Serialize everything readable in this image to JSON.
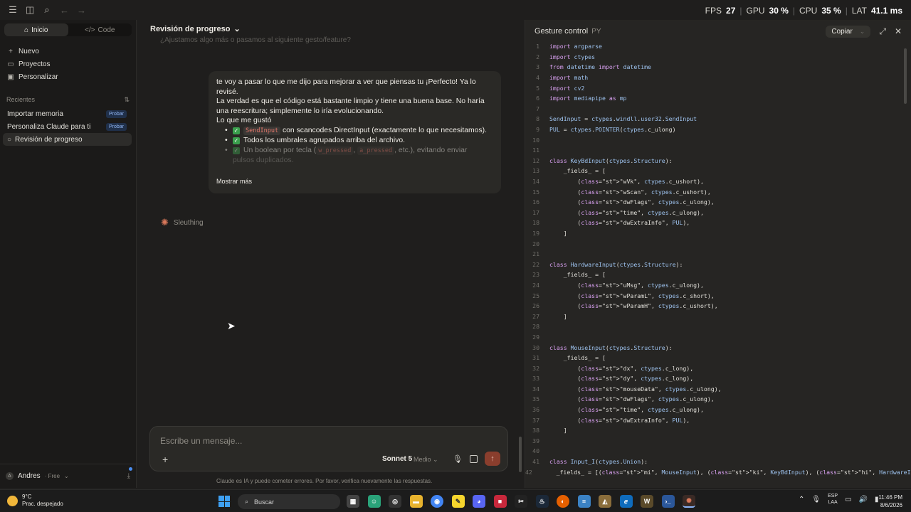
{
  "topbar": {
    "icons": [
      "menu-icon",
      "sidebar-toggle-icon",
      "search-icon",
      "back-icon",
      "forward-icon"
    ]
  },
  "overlay": {
    "fps_label": "FPS",
    "fps": "27",
    "gpu_label": "GPU",
    "gpu": "30 %",
    "cpu_label": "CPU",
    "cpu": "35 %",
    "lat_label": "LAT",
    "lat": "41.1 ms"
  },
  "sidebar": {
    "tabs": [
      {
        "label": "Inicio",
        "icon": "home-icon"
      },
      {
        "label": "Code",
        "icon": "code-icon"
      }
    ],
    "items": [
      {
        "label": "Nuevo",
        "icon": "plus-icon"
      },
      {
        "label": "Proyectos",
        "icon": "folder-icon"
      },
      {
        "label": "Personalizar",
        "icon": "briefcase-icon"
      }
    ],
    "recents_label": "Recientes",
    "recents": [
      {
        "label": "Importar memoria",
        "badge": "Probar"
      },
      {
        "label": "Personaliza Claude para ti",
        "badge": "Probar"
      },
      {
        "label": "Revisión de progreso",
        "badge": ""
      }
    ],
    "user": {
      "initial": "A",
      "name": "Andres",
      "plan": "· Free"
    }
  },
  "chat": {
    "title": "Revisión de progreso",
    "faded_text": "¿Ajustamos algo más o pasamos al siguiente gesto/feature?",
    "message": {
      "line1": "te voy a pasar lo que me dijo para mejorar a ver que piensas tu ¡Perfecto! Ya lo revisé.",
      "line2": "La verdad es que el código está bastante limpio y tiene una buena base. No haría una reescritura; simplemente lo iría evolucionando.",
      "line3": "Lo que me gustó",
      "bullet1_code": "SendInput",
      "bullet1_text": " con scancodes DirectInput (exactamente lo que necesitamos).",
      "bullet2_text": "Todos los umbrales agrupados arriba del archivo.",
      "bullet3_pre": "Un boolean por tecla (",
      "bullet3_code1": "w_pressed",
      "bullet3_mid": ", ",
      "bullet3_code2": "a_pressed",
      "bullet3_post": ", etc.), evitando enviar",
      "bullet3_cont": "pulsos duplicados.",
      "more": "Mostrar más"
    },
    "status": "Sleuthing",
    "composer": {
      "placeholder": "Escribe un mensaje...",
      "model": "Sonnet 5",
      "effort": "Medio"
    },
    "disclaimer": "Claude es IA y puede cometer errores. Por favor, verifica nuevamente las respuestas."
  },
  "code_panel": {
    "title": "Gesture control",
    "lang": "PY",
    "copy": "Copiar",
    "lines": [
      "import argparse",
      "import ctypes",
      "from datetime import datetime",
      "import math",
      "import cv2",
      "import mediapipe as mp",
      "",
      "SendInput = ctypes.windll.user32.SendInput",
      "PUL = ctypes.POINTER(ctypes.c_ulong)",
      "",
      "",
      "class KeyBdInput(ctypes.Structure):",
      "    _fields_ = [",
      "        (\"wVk\", ctypes.c_ushort),",
      "        (\"wScan\", ctypes.c_ushort),",
      "        (\"dwFlags\", ctypes.c_ulong),",
      "        (\"time\", ctypes.c_ulong),",
      "        (\"dwExtraInfo\", PUL),",
      "    ]",
      "",
      "",
      "class HardwareInput(ctypes.Structure):",
      "    _fields_ = [",
      "        (\"uMsg\", ctypes.c_ulong),",
      "        (\"wParamL\", ctypes.c_short),",
      "        (\"wParamH\", ctypes.c_ushort),",
      "    ]",
      "",
      "",
      "class MouseInput(ctypes.Structure):",
      "    _fields_ = [",
      "        (\"dx\", ctypes.c_long),",
      "        (\"dy\", ctypes.c_long),",
      "        (\"mouseData\", ctypes.c_ulong),",
      "        (\"dwFlags\", ctypes.c_ulong),",
      "        (\"time\", ctypes.c_ulong),",
      "        (\"dwExtraInfo\", PUL),",
      "    ]",
      "",
      "",
      "class Input_I(ctypes.Union):",
      "    _fields_ = [(\"mi\", MouseInput), (\"ki\", KeyBdInput), (\"hi\", HardwareInput)]"
    ]
  },
  "taskbar": {
    "weather_temp": "9°C",
    "weather_desc": "Prac. despejado",
    "search": "Buscar",
    "lang1": "ESP",
    "lang2": "LAA",
    "time": "11:46 PM",
    "date": "8/6/2026"
  }
}
